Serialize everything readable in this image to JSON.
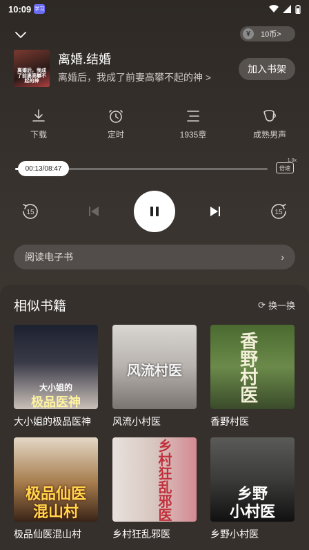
{
  "status": {
    "time": "10:09",
    "badge": "学习"
  },
  "header": {
    "coin_icon": "¥",
    "coin_label": "10币>"
  },
  "book": {
    "title": "离婚.结婚",
    "subtitle": "离婚后，我成了前妻高攀不起的神 >",
    "add_label": "加入书架",
    "cover_text": "离婚后，我成了前妻高攀不起的神"
  },
  "tools": [
    {
      "label": "下载",
      "icon": "download-icon"
    },
    {
      "label": "定时",
      "icon": "timer-icon"
    },
    {
      "label": "1935章",
      "icon": "chapter-list-icon"
    },
    {
      "label": "成熟男声",
      "icon": "voice-icon"
    }
  ],
  "player": {
    "time": "00:13/08:47",
    "progress": 0.025,
    "speed_label": "倍速",
    "speed_value": "1.0x",
    "rewind_label": "15",
    "forward_label": "15"
  },
  "read_bar": {
    "label": "阅读电子书",
    "arrow": "›"
  },
  "similar": {
    "title": "相似书籍",
    "refresh_icon": "⟳",
    "refresh_label": "换一换",
    "books": [
      {
        "name": "大小姐的极品医神",
        "cover_line1": "大小姐的",
        "cover_line2": "极品医神",
        "color1": "#1d2230",
        "color2": "#c9c0b8"
      },
      {
        "name": "风流小村医",
        "cover_line1": "",
        "cover_line2": "风流村医",
        "color1": "#d9d6d2",
        "color2": "#7b7571"
      },
      {
        "name": "香野村医",
        "cover_line1": "",
        "cover_line2": "香野村医",
        "color1": "#5f7c3c",
        "color2": "#3a4b2a"
      },
      {
        "name": "极品仙医混山村",
        "cover_line1": "极品仙医",
        "cover_line2": "混山村",
        "color1": "#a47a4a",
        "color2": "#3a2418"
      },
      {
        "name": "乡村狂乱邪医",
        "cover_line1": "",
        "cover_line2": "乡村狂乱邪医",
        "color1": "#e8e1dc",
        "color2": "#d48a92"
      },
      {
        "name": "乡野小村医",
        "cover_line1": "乡野",
        "cover_line2": "小村医",
        "color1": "#3b3b3a",
        "color2": "#111111"
      }
    ]
  }
}
